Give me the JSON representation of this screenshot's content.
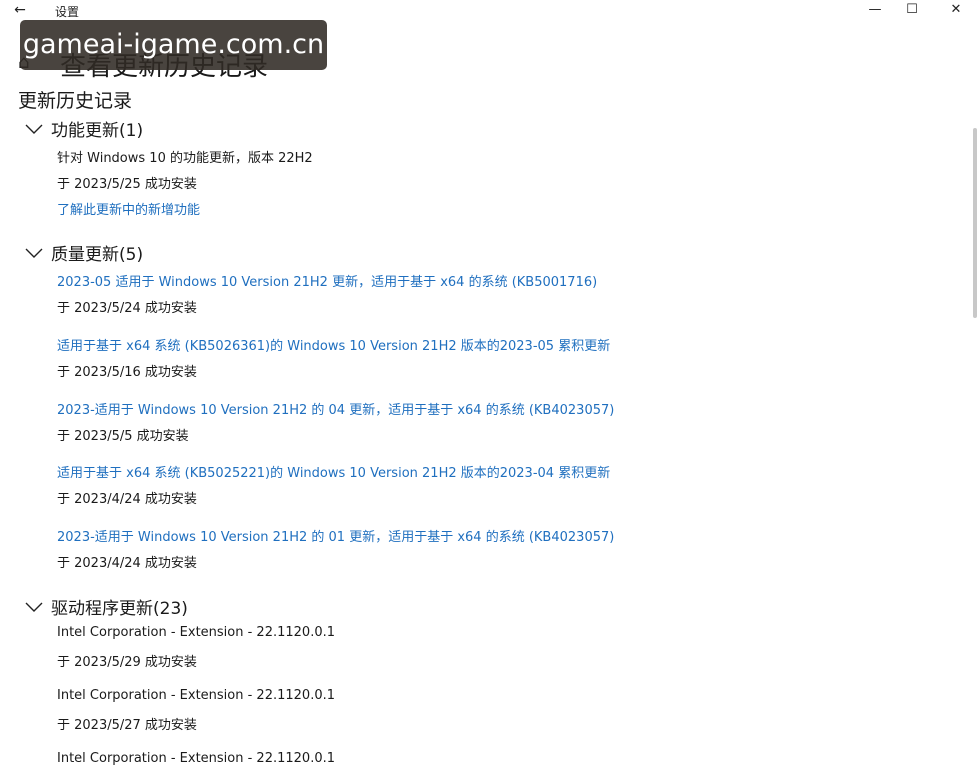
{
  "window": {
    "title": "设置",
    "back_icon": "←",
    "minimize_icon": "—",
    "maximize_icon": "☐",
    "close_icon": "✕"
  },
  "watermark": "gameai-igame.com.cn",
  "page": {
    "home_icon": "⌂",
    "title": "查看更新历史记录",
    "section_title": "更新历史记录"
  },
  "groups": {
    "feature": {
      "header": "功能更新(1)",
      "items": [
        {
          "name": "针对 Windows 10 的功能更新，版本 22H2",
          "status": "于 2023/5/25 成功安装",
          "link": "了解此更新中的新增功能"
        }
      ]
    },
    "quality": {
      "header": "质量更新(5)",
      "items": [
        {
          "name": "2023-05 适用于 Windows 10 Version 21H2 更新，适用于基于 x64 的系统 (KB5001716)",
          "status": "于 2023/5/24 成功安装"
        },
        {
          "name": "适用于基于 x64 系统 (KB5026361)的 Windows 10 Version 21H2 版本的2023-05 累积更新",
          "status": "于 2023/5/16 成功安装"
        },
        {
          "name": "2023-适用于 Windows 10 Version 21H2 的 04 更新，适用于基于 x64 的系统 (KB4023057)",
          "status": "于 2023/5/5 成功安装"
        },
        {
          "name": "适用于基于 x64 系统 (KB5025221)的 Windows 10 Version 21H2 版本的2023-04 累积更新",
          "status": "于 2023/4/24 成功安装"
        },
        {
          "name": "2023-适用于 Windows 10 Version 21H2 的 01 更新，适用于基于 x64 的系统 (KB4023057)",
          "status": "于 2023/4/24 成功安装"
        }
      ]
    },
    "driver": {
      "header": "驱动程序更新(23)",
      "items": [
        {
          "name": "Intel Corporation - Extension - 22.1120.0.1",
          "status": "于 2023/5/29 成功安装"
        },
        {
          "name": "Intel Corporation - Extension - 22.1120.0.1",
          "status": "于 2023/5/27 成功安装"
        },
        {
          "name": "Intel Corporation - Extension - 22.1120.0.1"
        }
      ]
    }
  }
}
